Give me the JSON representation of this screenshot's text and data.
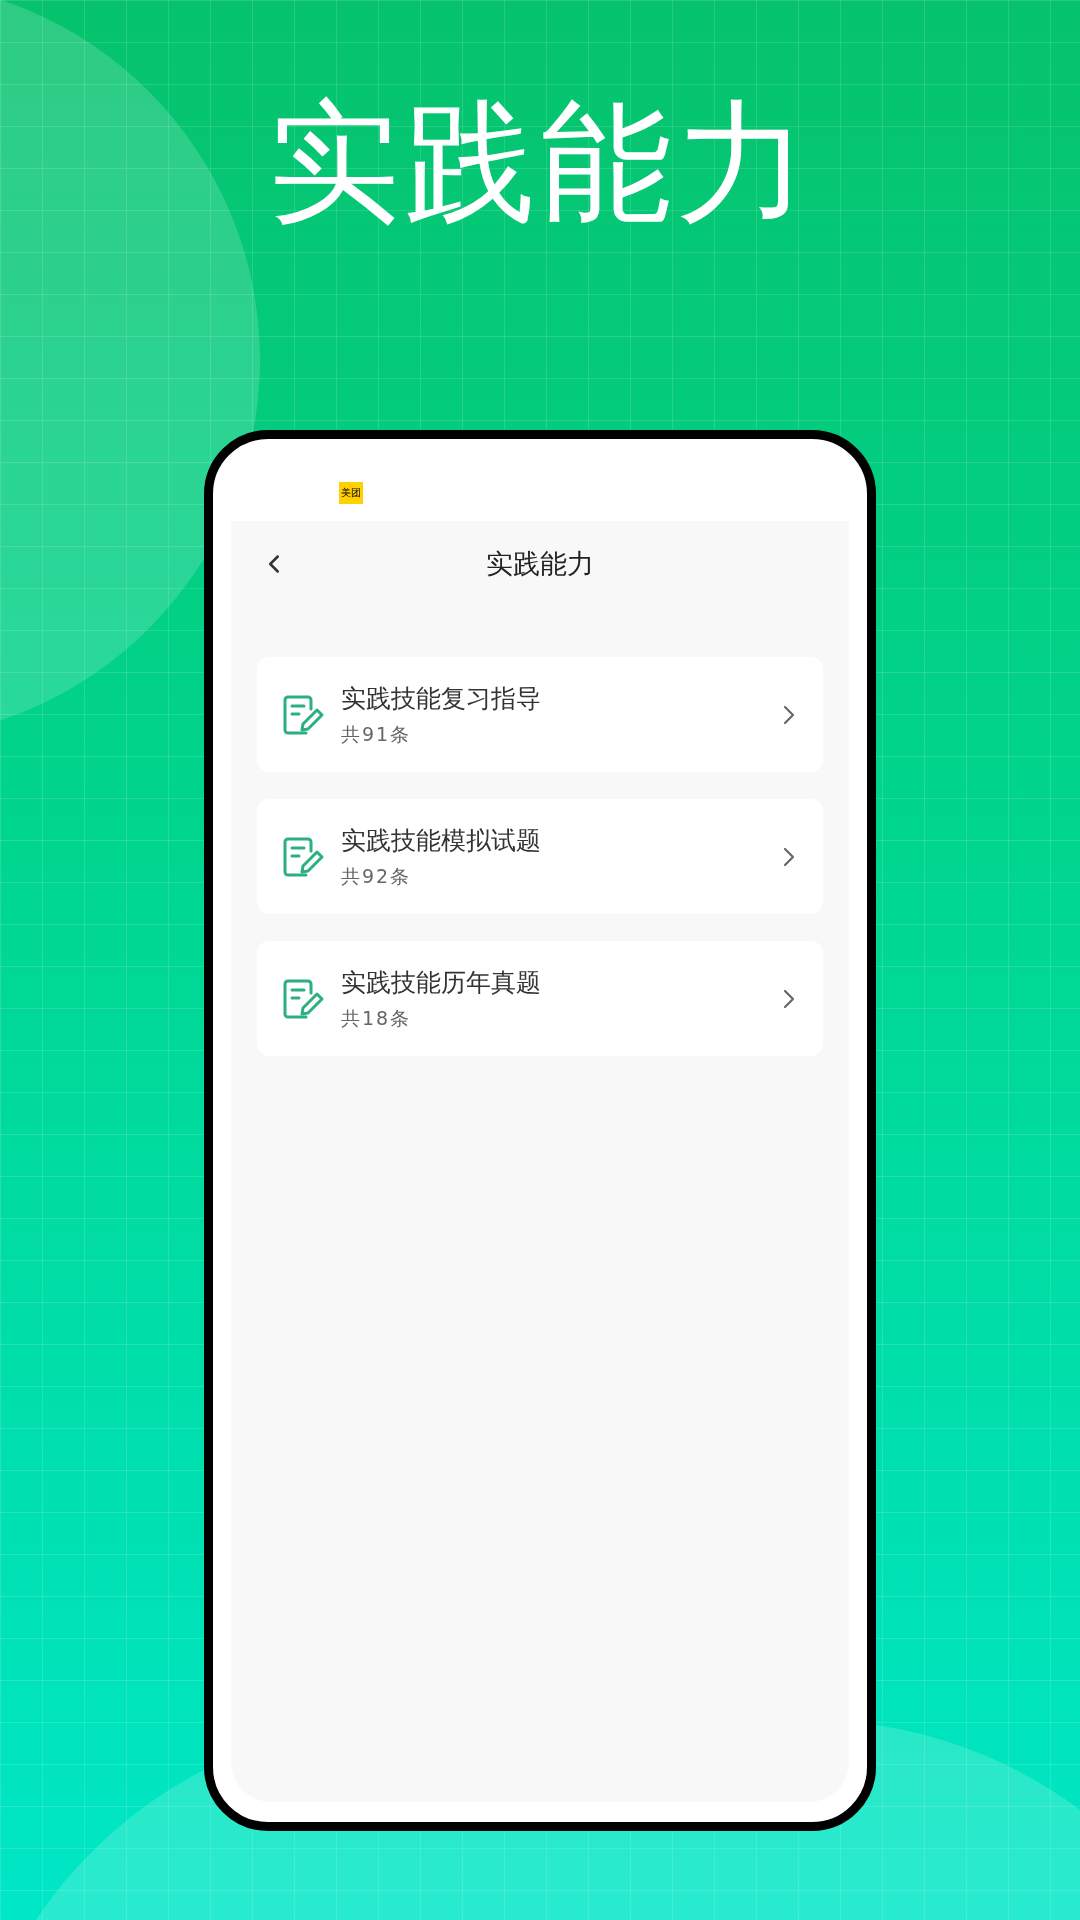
{
  "headline": "实践能力",
  "status_bar": {
    "app_badge": "美团"
  },
  "header": {
    "title": "实践能力"
  },
  "items": [
    {
      "title": "实践技能复习指导",
      "count": "共91条"
    },
    {
      "title": "实践技能模拟试题",
      "count": "共92条"
    },
    {
      "title": "实践技能历年真题",
      "count": "共18条"
    }
  ]
}
